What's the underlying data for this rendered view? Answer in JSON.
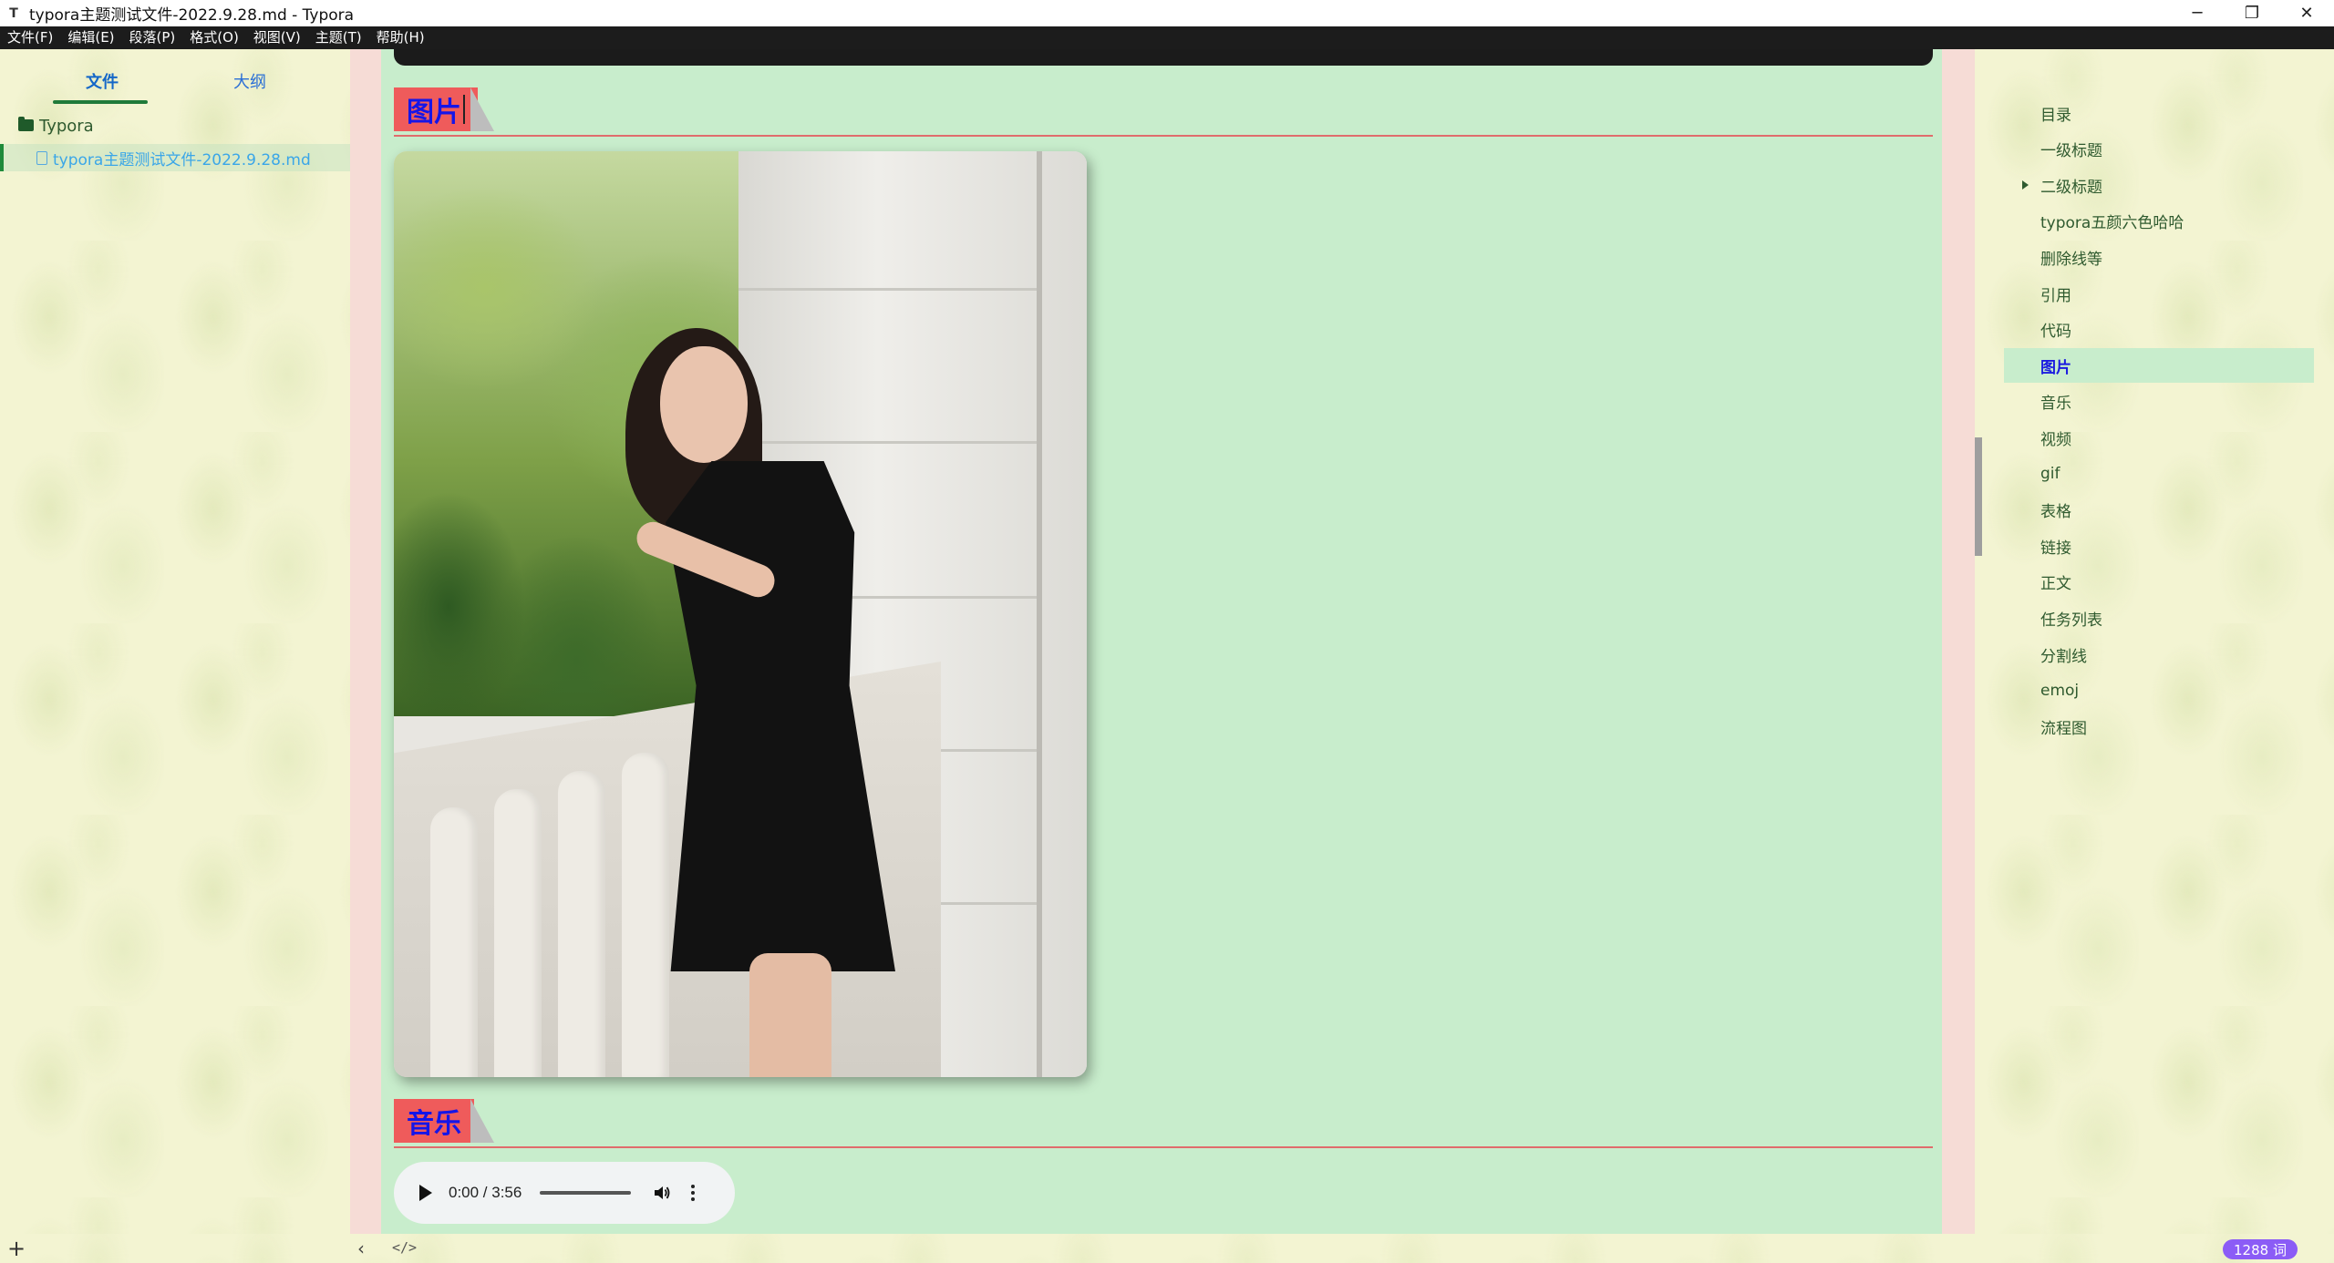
{
  "window": {
    "icon": "T",
    "title": "typora主题测试文件-2022.9.28.md - Typora",
    "controls": {
      "minimize": "─",
      "restore": "❐",
      "close": "✕"
    }
  },
  "menu": [
    "文件(F)",
    "编辑(E)",
    "段落(P)",
    "格式(O)",
    "视图(V)",
    "主题(T)",
    "帮助(H)"
  ],
  "sidebar": {
    "tabs": {
      "files": "文件",
      "outline": "大纲"
    },
    "active_tab": "files",
    "tree": {
      "root": "Typora",
      "file": "typora主题测试文件-2022.9.28.md"
    }
  },
  "editor": {
    "heading_image": "图片",
    "heading_music": "音乐",
    "audio": {
      "time": "0:00 / 3:56",
      "progress": 0.0
    }
  },
  "outline": {
    "items": [
      "目录",
      "一级标题",
      "二级标题",
      "typora五颜六色哈哈",
      "删除线等",
      "引用",
      "代码",
      "图片",
      "音乐",
      "视频",
      "gif",
      "表格",
      "链接",
      "正文",
      "任务列表",
      "分割线",
      "emoj",
      "流程图"
    ],
    "active_item": "图片",
    "collapsible_item": "二级标题"
  },
  "statusbar": {
    "add": "+",
    "back": "‹",
    "source": "</>",
    "word_count": "1288 词"
  },
  "colors": {
    "accent_heading_bg": "#ef5b5b",
    "heading_text": "#1515e8",
    "editor_bg": "#c8edcc",
    "word_count_badge": "#8b5cf6"
  }
}
